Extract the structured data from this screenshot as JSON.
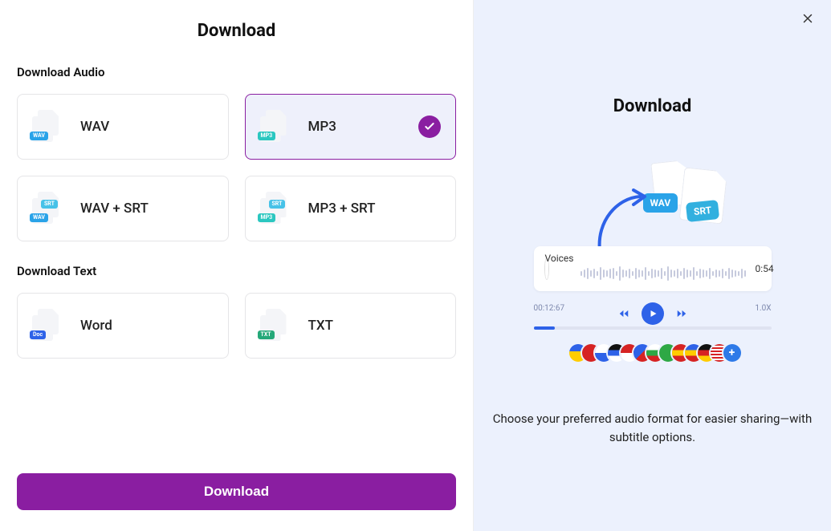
{
  "left": {
    "title": "Download",
    "audio_label": "Download Audio",
    "text_label": "Download Text",
    "options": {
      "wav": {
        "label": "WAV",
        "badge_main": "WAV"
      },
      "mp3": {
        "label": "MP3",
        "badge_main": "MP3"
      },
      "wav_srt": {
        "label": "WAV + SRT",
        "badge_main": "WAV",
        "badge_aux": "SRT"
      },
      "mp3_srt": {
        "label": "MP3 + SRT",
        "badge_main": "MP3",
        "badge_aux": "SRT"
      },
      "word": {
        "label": "Word",
        "badge_main": "Doc"
      },
      "txt": {
        "label": "TXT",
        "badge_main": "TXT"
      }
    },
    "primary_button": "Download",
    "selected": "mp3"
  },
  "right": {
    "title": "Download",
    "chip_wav": "WAV",
    "chip_srt": "SRT",
    "voice_label": "Voices",
    "voice_time": "0:54",
    "elapsed": "00:12:67",
    "speed": "1.0X",
    "desc": "Choose your preferred audio format for easier sharing—with subtitle options."
  }
}
